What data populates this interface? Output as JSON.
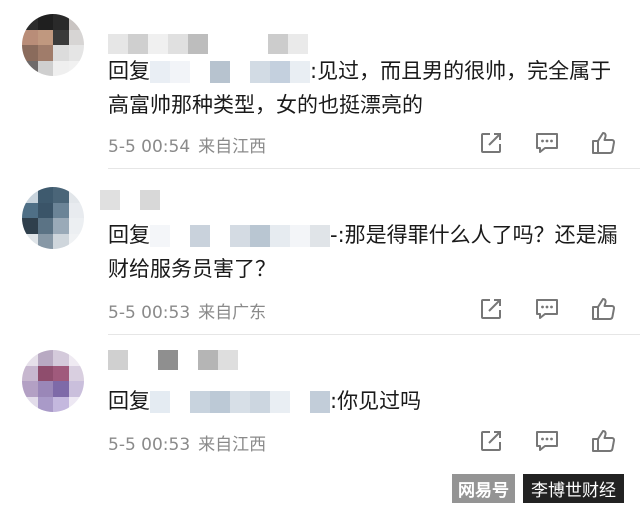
{
  "comments": [
    {
      "reply_prefix": "回复",
      "text_after": ":见过，而且男的很帅，完全属于高富帅那种类型，女的也挺漂亮的",
      "time": "5-5 00:54",
      "location": "来自江西",
      "avatar_icon": "pixelated-avatar",
      "icons": [
        "share-icon",
        "comment-icon",
        "like-icon"
      ]
    },
    {
      "reply_prefix": "回复",
      "text_after": "-:那是得罪什么人了吗？还是漏财给服务员害了？",
      "time": "5-5 00:53",
      "location": "来自广东",
      "avatar_icon": "pixelated-avatar",
      "icons": [
        "share-icon",
        "comment-icon",
        "like-icon"
      ]
    },
    {
      "reply_prefix": "回复",
      "text_after": ":你见过吗",
      "time": "5-5 00:53",
      "location": "来自江西",
      "avatar_icon": "pixelated-avatar",
      "icons": [
        "share-icon",
        "comment-icon",
        "like-icon"
      ]
    }
  ],
  "watermark": {
    "logo": "网易号",
    "account": "李博世财经"
  },
  "colors": {
    "meta_text": "#8a8a8a",
    "body_text": "#1a1a1a",
    "divider": "#e6e6e6"
  }
}
